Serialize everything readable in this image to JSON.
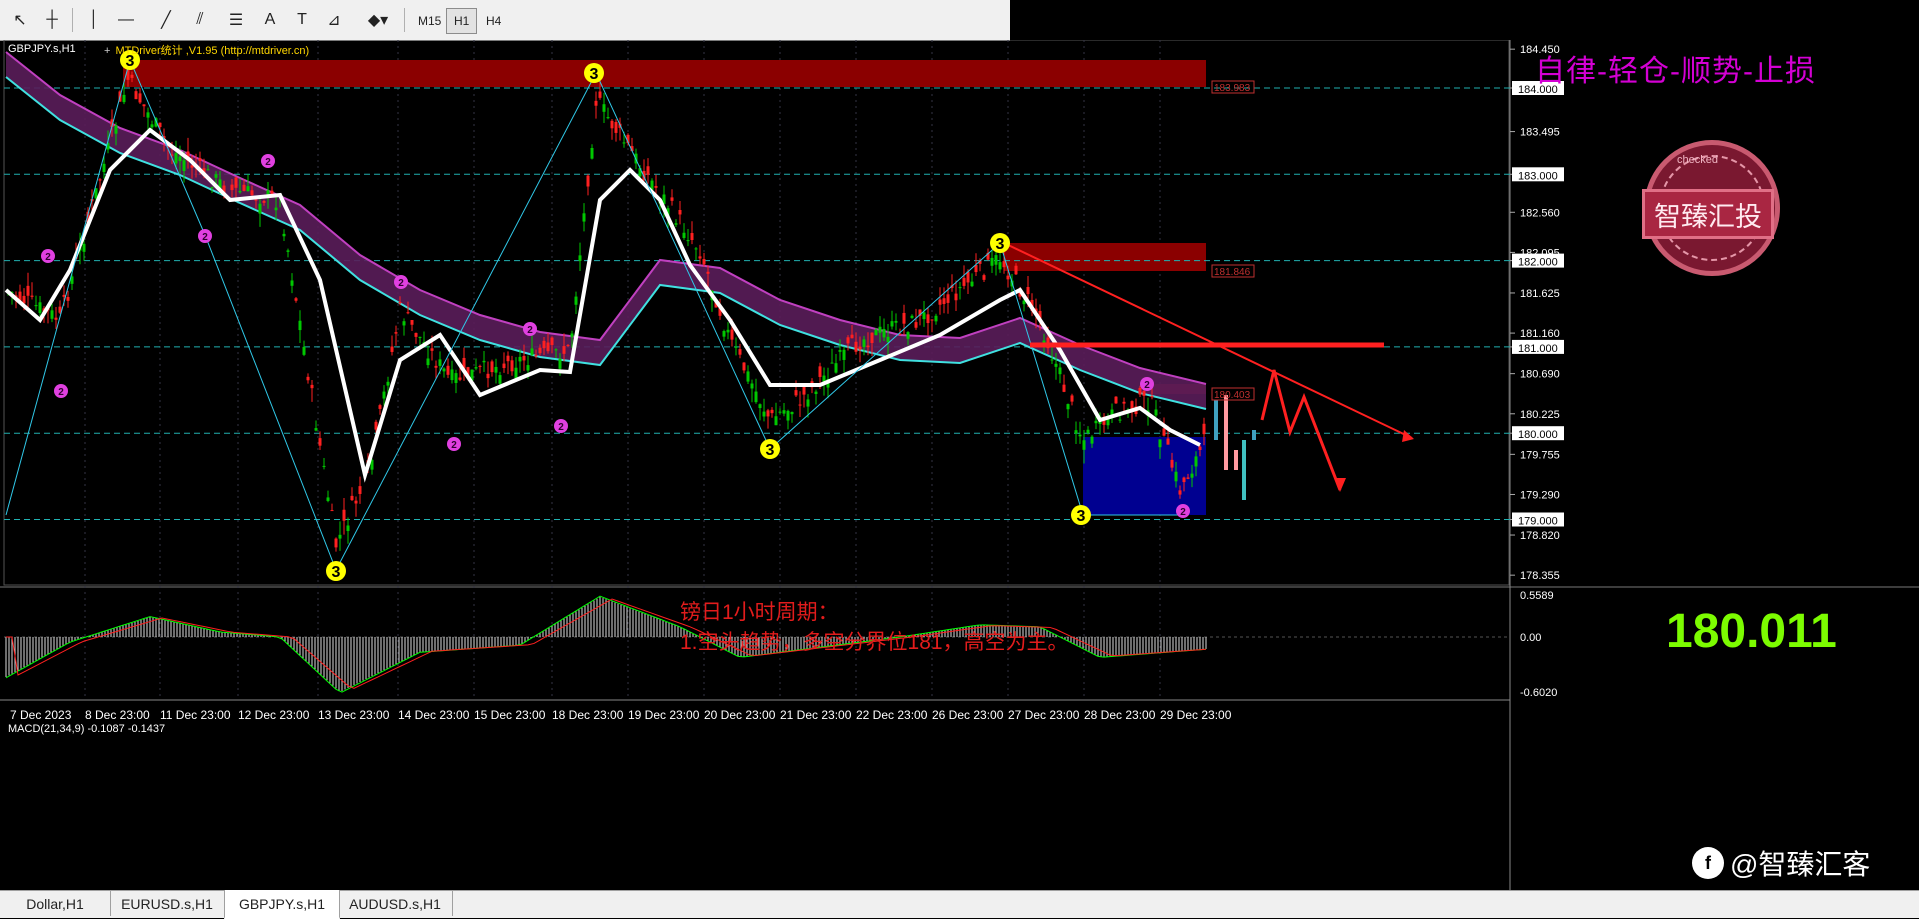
{
  "toolbar": {
    "tools": [
      {
        "icon": "cursor-icon",
        "glyph": "↖"
      },
      {
        "icon": "crosshair-icon",
        "glyph": "┼"
      },
      {
        "icon": "vertical-line-icon",
        "glyph": "│"
      },
      {
        "icon": "horizontal-line-icon",
        "glyph": "―"
      },
      {
        "icon": "trendline-icon",
        "glyph": "╱"
      },
      {
        "icon": "channel-icon",
        "glyph": "⫽"
      },
      {
        "icon": "fibonacci-icon",
        "glyph": "☰"
      },
      {
        "icon": "text-icon",
        "glyph": "A"
      },
      {
        "icon": "text-label-icon",
        "glyph": "T"
      },
      {
        "icon": "fibo-fan-icon",
        "glyph": "⊿"
      },
      {
        "icon": "shapes-dropdown-icon",
        "glyph": "◆▾"
      }
    ],
    "timeframes": [
      "M15",
      "H1",
      "H4"
    ],
    "active_timeframe": "H1"
  },
  "chart": {
    "symbol_title": "GBPJPY.s,H1",
    "indicator_label": "MTDriver统计 ,V1.95 (http://mtdriver.cn)",
    "slogan": "自律-轻仓-顺势-止损",
    "seal_text": "智臻汇投",
    "seal_ring_text": "checked",
    "annotation_title": "镑日1小时周期：",
    "annotation_body": "1.空头趋势，多空分界位181，高空为主。",
    "big_price": "180.011",
    "watermark": "@智臻汇客",
    "macd_label": "MACD(21,34,9) -0.1087 -0.1437",
    "price_axis": [
      "184.450",
      "184.000",
      "183.495",
      "183.000",
      "182.560",
      "182.095",
      "182.000",
      "181.625",
      "181.160",
      "181.000",
      "180.690",
      "180.225",
      "180.000",
      "179.755",
      "179.290",
      "179.000",
      "178.820",
      "178.355"
    ],
    "highlighted_levels": [
      "184.000",
      "183.000",
      "182.000",
      "181.000",
      "180.000",
      "179.000"
    ],
    "zone_labels": [
      "183.983",
      "181.846",
      "180.403"
    ],
    "macd_axis": [
      "0.5589",
      "0.00",
      "-0.6020"
    ],
    "time_axis": [
      "7 Dec 2023",
      "8 Dec 23:00",
      "11 Dec 23:00",
      "12 Dec 23:00",
      "13 Dec 23:00",
      "14 Dec 23:00",
      "15 Dec 23:00",
      "18 Dec 23:00",
      "19 Dec 23:00",
      "20 Dec 23:00",
      "21 Dec 23:00",
      "22 Dec 23:00",
      "26 Dec 23:00",
      "27 Dec 23:00",
      "28 Dec 23:00",
      "29 Dec 23:00"
    ],
    "markers": [
      "3",
      "2"
    ]
  },
  "tabs": [
    "Dollar,H1",
    "EURUSD.s,H1",
    "GBPJPY.s,H1",
    "AUDUSD.s,H1"
  ],
  "active_tab": "GBPJPY.s,H1",
  "colors": {
    "background": "#000000",
    "candle_bull": "#00c800",
    "candle_bear": "#ff2020",
    "ma_white": "#ffffff",
    "cloud_upper": "#c040c0",
    "cloud_lower": "#40e0e0",
    "resistance_zone": "#8b0000",
    "support_zone": "#000090",
    "trendline": "#ff2020",
    "level_line": "#20b0b0",
    "marker_three": "#ffff00",
    "marker_two": "#e040e0"
  }
}
